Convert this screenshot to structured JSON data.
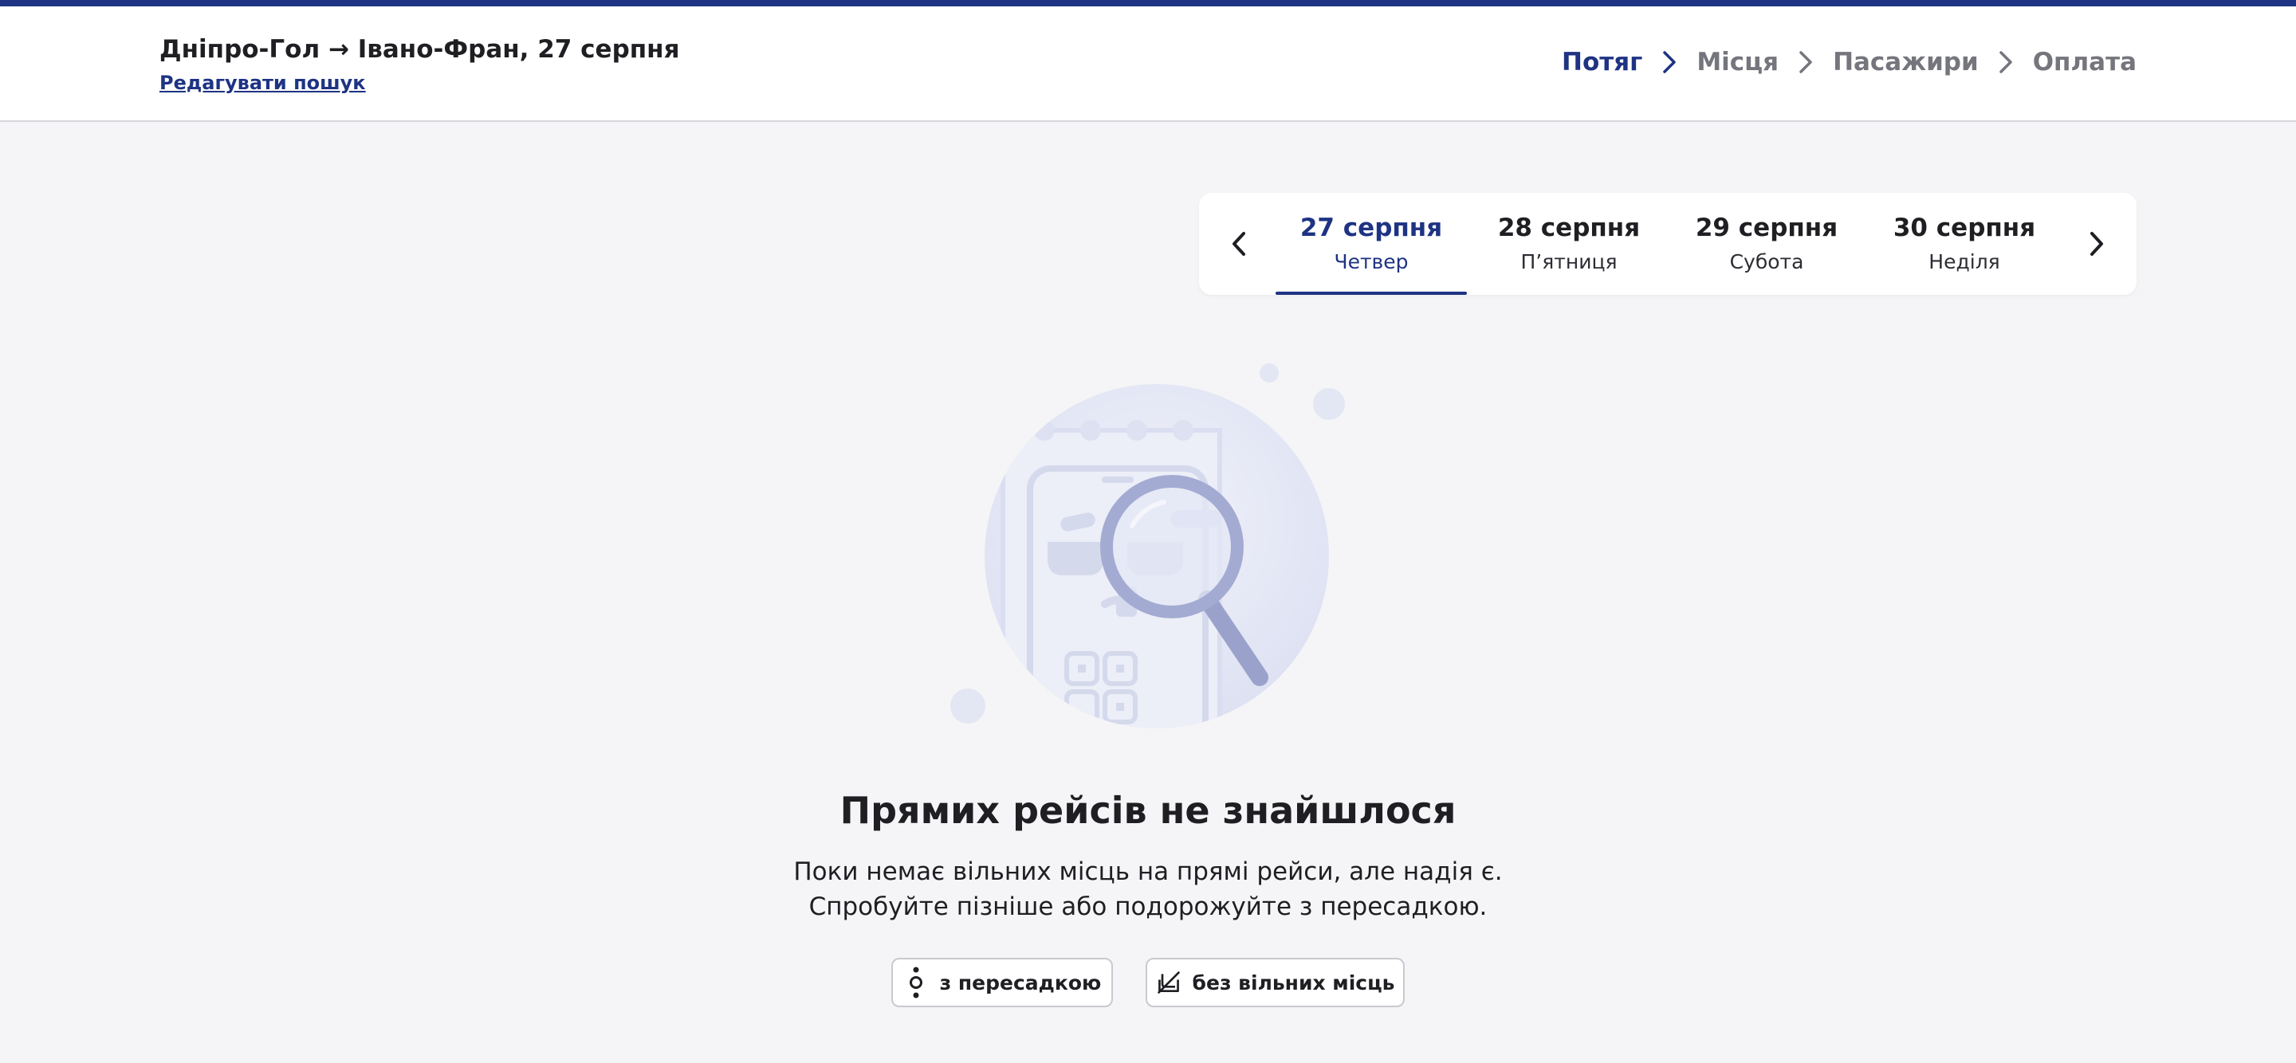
{
  "header": {
    "route_title": "Дніпро-Гол → Івано-Фран, 27 серпня",
    "edit_link": "Редагувати пошук"
  },
  "steps": [
    {
      "label": "Потяг",
      "active": true
    },
    {
      "label": "Місця",
      "active": false
    },
    {
      "label": "Пасажири",
      "active": false
    },
    {
      "label": "Оплата",
      "active": false
    }
  ],
  "dates": [
    {
      "date": "27 серпня",
      "weekday": "Четвер",
      "active": true
    },
    {
      "date": "28 серпня",
      "weekday": "П’ятниця",
      "active": false
    },
    {
      "date": "29 серпня",
      "weekday": "Субота",
      "active": false
    },
    {
      "date": "30 серпня",
      "weekday": "Неділя",
      "active": false
    }
  ],
  "empty_state": {
    "title": "Прямих рейсів не знайшлося",
    "line1": "Поки немає вільних місць на прямі рейси, але надія є.",
    "line2": "Спробуйте пізніше або подорожуйте з пересадкою."
  },
  "buttons": {
    "transfer": "з пересадкою",
    "no_seats": "без вільних місць"
  },
  "colors": {
    "accent": "#1e3383",
    "background": "#f5f5f7",
    "muted": "#75757d"
  },
  "icons": {
    "transfer": "transfer-route-icon",
    "no_seats": "seat-unavailable-icon"
  }
}
